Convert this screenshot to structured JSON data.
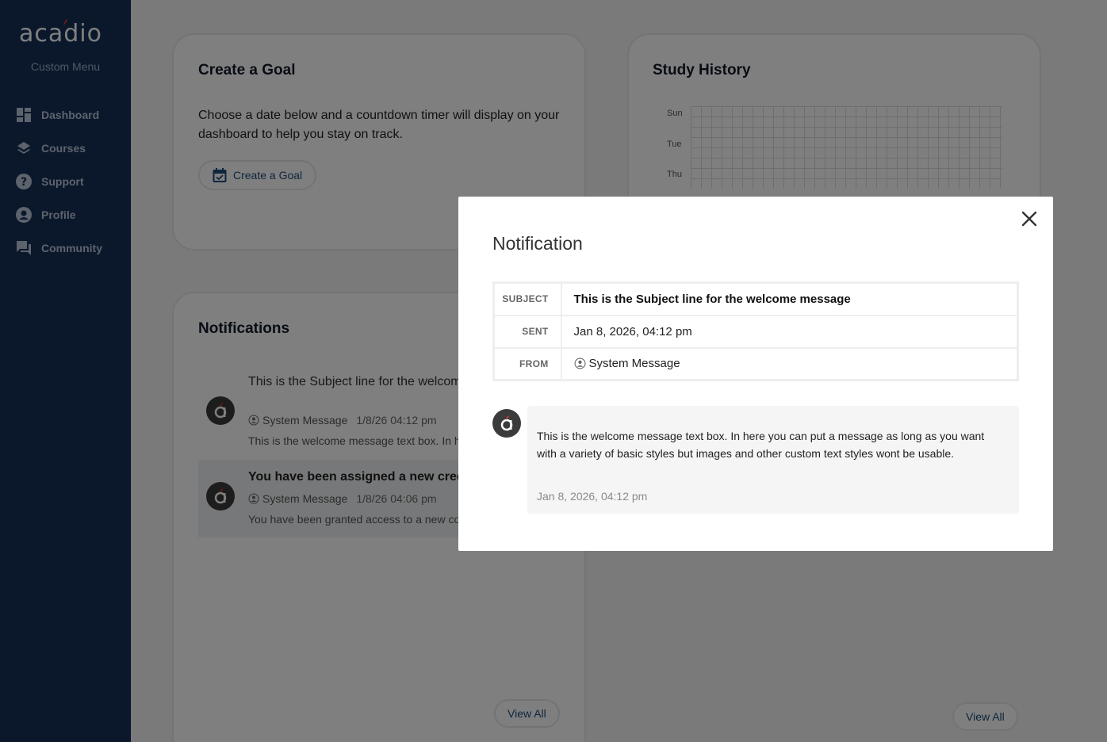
{
  "sidebar": {
    "logo_text": "acádio",
    "menu_title": "Custom Menu",
    "items": [
      {
        "label": "Dashboard",
        "icon": "dashboard-icon"
      },
      {
        "label": "Courses",
        "icon": "layers-icon"
      },
      {
        "label": "Support",
        "icon": "help-icon"
      },
      {
        "label": "Profile",
        "icon": "user-circle-icon"
      },
      {
        "label": "Community",
        "icon": "forum-icon"
      }
    ]
  },
  "goal_card": {
    "title": "Create a Goal",
    "description": "Choose a date below and a countdown timer will display on your dashboard to help you stay on track.",
    "button_label": "Create a Goal"
  },
  "history_card": {
    "title": "Study History",
    "day_labels": [
      "Sun",
      "Tue",
      "Thu"
    ],
    "view_all_label": "View All"
  },
  "notifications_card": {
    "title": "Notifications",
    "view_all_label": "View All",
    "items": [
      {
        "subject": "This is the Subject line for the welcome message",
        "sender": "System Message",
        "date": "1/8/26 04:12 pm",
        "preview": "This is the welcome message text box. In here you can put a message",
        "unread": false
      },
      {
        "subject": "You have been assigned a new credit",
        "sender": "System Message",
        "date": "1/8/26 04:06 pm",
        "preview": "You have been granted access to a new course",
        "unread": true
      }
    ]
  },
  "modal": {
    "title": "Notification",
    "subject_label": "SUBJECT",
    "subject_value": "This is the Subject line for the welcome message",
    "sent_label": "SENT",
    "sent_value": "Jan 8, 2026, 04:12 pm",
    "from_label": "FROM",
    "from_value": "System Message",
    "message_body": "This is the welcome message text box. In here you can put a message as long as you want with a variety of basic styles but images and other custom text styles wont be usable.",
    "message_date": "Jan 8, 2026, 04:12 pm"
  },
  "colors": {
    "sidebar_bg": "#163156",
    "accent": "#1e4b7a",
    "logo_accent": "#e23b2e"
  }
}
